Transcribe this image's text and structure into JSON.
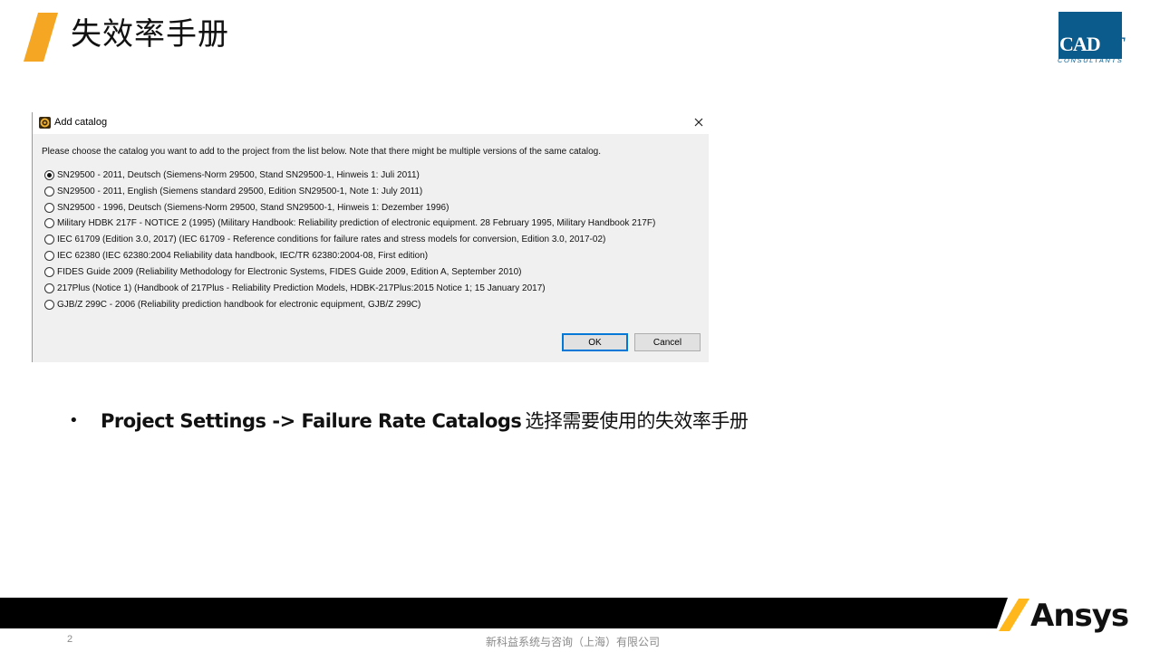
{
  "slide": {
    "title": "失效率手册",
    "accent_color": "#f5a623",
    "bullet_bold": "Project Settings -> Failure Rate Catalogs",
    "bullet_rest": "选择需要使用的失效率手册",
    "bullet_symbol": "•"
  },
  "logo": {
    "main": "CAD",
    "suffix": "-IT",
    "sub": "CONSULTANTS",
    "color": "#0b5c8c"
  },
  "dialog": {
    "title": "Add catalog",
    "message": "Please choose the catalog you want to add to the project from the list below. Note that there might be multiple versions of the same catalog.",
    "options": [
      {
        "label": "SN29500 - 2011, Deutsch (Siemens-Norm 29500, Stand SN29500-1, Hinweis 1: Juli 2011)",
        "selected": true
      },
      {
        "label": "SN29500 - 2011, English (Siemens standard 29500, Edition SN29500-1, Note 1: July 2011)",
        "selected": false
      },
      {
        "label": "SN29500 - 1996, Deutsch (Siemens-Norm 29500, Stand SN29500-1, Hinweis 1: Dezember 1996)",
        "selected": false
      },
      {
        "label": "Military HDBK 217F - NOTICE 2 (1995) (Military Handbook: Reliability prediction of electronic equipment. 28 February 1995, Military Handbook 217F)",
        "selected": false
      },
      {
        "label": "IEC 61709 (Edition 3.0, 2017) (IEC 61709 - Reference conditions for failure rates and stress models for conversion, Edition 3.0, 2017-02)",
        "selected": false
      },
      {
        "label": "IEC 62380 (IEC 62380:2004 Reliability data handbook, IEC/TR 62380:2004-08, First edition)",
        "selected": false
      },
      {
        "label": "FIDES Guide 2009 (Reliability Methodology for Electronic Systems, FIDES Guide 2009, Edition A, September 2010)",
        "selected": false
      },
      {
        "label": "217Plus (Notice 1) (Handbook of 217Plus - Reliability Prediction Models, HDBK-217Plus:2015 Notice 1; 15 January 2017)",
        "selected": false
      },
      {
        "label": "GJB/Z 299C - 2006 (Reliability prediction handbook for electronic equipment, GJB/Z 299C)",
        "selected": false
      }
    ],
    "ok_label": "OK",
    "cancel_label": "Cancel",
    "focus_color": "#0078d7"
  },
  "footer": {
    "page_number": "2",
    "company": "新科益系统与咨询（上海）有限公司",
    "brand": "Ansys",
    "brand_accent": "#ffb71b"
  }
}
